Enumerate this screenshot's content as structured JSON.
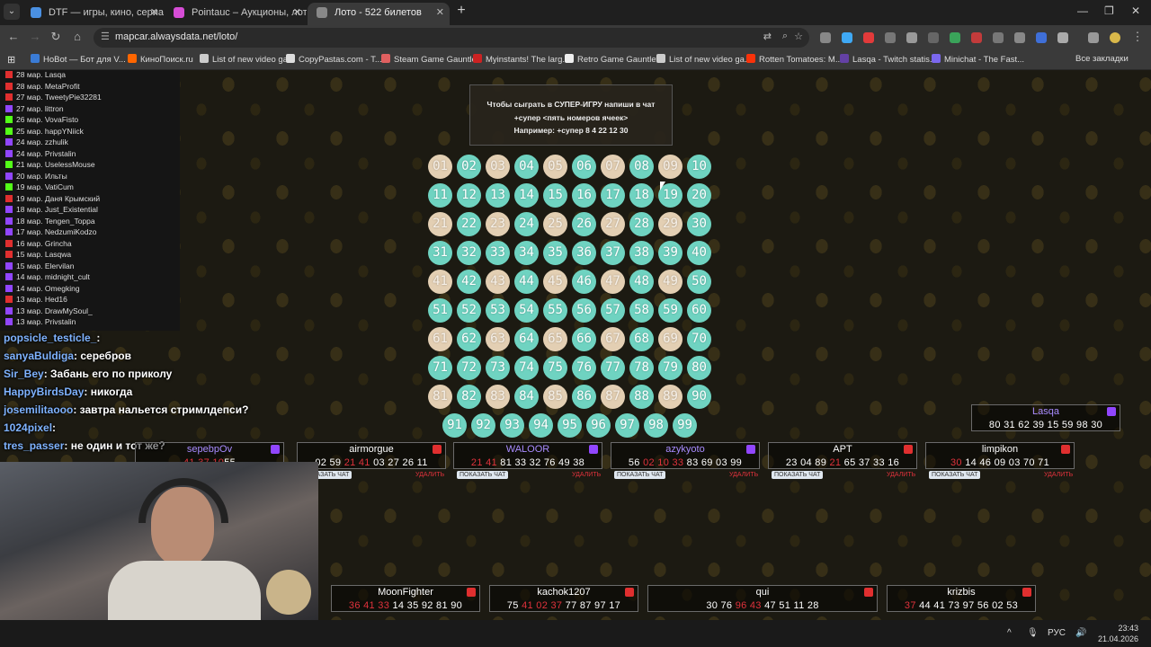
{
  "browser": {
    "tabs": [
      {
        "title": "DTF — игры, кино, сериалы, р",
        "active": false,
        "color": "#4a90e2"
      },
      {
        "title": "Pointauc – Аукционы, лотере",
        "active": false,
        "color": "#d64dd6"
      },
      {
        "title": "Лото - 522 билетов",
        "active": true,
        "color": "#888888"
      }
    ],
    "url": "mapcar.alwaysdata.net/loto/",
    "bookmarks": [
      {
        "label": "HoBot — Бот для V...",
        "color": "#3a7bd5"
      },
      {
        "label": "КиноПоиск.ru",
        "color": "#ff6600"
      },
      {
        "label": "List of new video ga...",
        "color": "#cccccc"
      },
      {
        "label": "CopyPastas.com - T...",
        "color": "#dddddd"
      },
      {
        "label": "Steam Game Gauntlet",
        "color": "#e06060"
      },
      {
        "label": "Myinstants! The larg...",
        "color": "#cc2222"
      },
      {
        "label": "Retro Game Gauntlet",
        "color": "#eeeeee"
      },
      {
        "label": "List of new video ga...",
        "color": "#cccccc"
      },
      {
        "label": "Rotten Tomatoes: M...",
        "color": "#fa320a"
      },
      {
        "label": "Lasqa - Twitch statis...",
        "color": "#6441a5"
      },
      {
        "label": "Minichat - The Fast...",
        "color": "#7b68ee"
      }
    ],
    "all_bookmarks": "Все закладки"
  },
  "chat_history": [
    {
      "text": "28 мар. Lasqa",
      "platform": "youtube"
    },
    {
      "text": "28 мар. MetaProfit",
      "platform": "youtube"
    },
    {
      "text": "27 мар. TweetyPie32281",
      "platform": "youtube"
    },
    {
      "text": "27 мар. littron",
      "platform": "twitch"
    },
    {
      "text": "26 мар. VovaFisto",
      "platform": "kick"
    },
    {
      "text": "25 мар. happYNiick",
      "platform": "kick"
    },
    {
      "text": "24 мар. zzhulik",
      "platform": "twitch"
    },
    {
      "text": "24 мар. Privstalin",
      "platform": "twitch"
    },
    {
      "text": "21 мар. UselessMouse",
      "platform": "kick"
    },
    {
      "text": "20 мар. Ильты",
      "platform": "twitch"
    },
    {
      "text": "19 мар. VatiCum",
      "platform": "kick"
    },
    {
      "text": "19 мар. Даня Крымский",
      "platform": "youtube"
    },
    {
      "text": "18 мар. Just_Existential",
      "platform": "twitch"
    },
    {
      "text": "18 мар. Tengen_Toppa",
      "platform": "twitch"
    },
    {
      "text": "17 мар. NedzumiKodzo",
      "platform": "twitch"
    },
    {
      "text": "16 мар. Grincha",
      "platform": "youtube"
    },
    {
      "text": "15 мар. Lasqwa",
      "platform": "youtube"
    },
    {
      "text": "15 мар. Elervilan",
      "platform": "twitch"
    },
    {
      "text": "14 мар. midnight_cult",
      "platform": "twitch"
    },
    {
      "text": "14 мар. Omegking",
      "platform": "twitch"
    },
    {
      "text": "13 мар. Hed16",
      "platform": "youtube"
    },
    {
      "text": "13 мар. DrawMySoul_",
      "platform": "twitch"
    },
    {
      "text": "13 мар. Privstalin",
      "platform": "twitch"
    }
  ],
  "overlay_chat": [
    {
      "name": "popsicle_testicle_",
      "text": ":"
    },
    {
      "name": "sanyaBuldiga",
      "text": ": серебров"
    },
    {
      "name": "Sir_Bey",
      "text": ": Забань его по приколу"
    },
    {
      "name": "HappyBirdsDay",
      "text": ": никогда"
    },
    {
      "name": "josemilitaooo",
      "text": ": завтра нальется стримлдепси?"
    },
    {
      "name": "1024pixel",
      "text": ":"
    },
    {
      "name": "tres_passer",
      "text": ": не один и тот же?"
    }
  ],
  "info_box": {
    "line1": "Чтобы сыграть в СУПЕР-ИГРУ напиши в чат",
    "line2": "+супер <пять номеров ячеек>",
    "line3": "Например: +супер 8 4 22 12 30"
  },
  "balls": [
    {
      "n": "01",
      "c": "b"
    },
    {
      "n": "02",
      "c": "t"
    },
    {
      "n": "03",
      "c": "b"
    },
    {
      "n": "04",
      "c": "t"
    },
    {
      "n": "05",
      "c": "b"
    },
    {
      "n": "06",
      "c": "t"
    },
    {
      "n": "07",
      "c": "b"
    },
    {
      "n": "08",
      "c": "t"
    },
    {
      "n": "09",
      "c": "b"
    },
    {
      "n": "10",
      "c": "t"
    },
    {
      "n": "11",
      "c": "t"
    },
    {
      "n": "12",
      "c": "t"
    },
    {
      "n": "13",
      "c": "t"
    },
    {
      "n": "14",
      "c": "t"
    },
    {
      "n": "15",
      "c": "t"
    },
    {
      "n": "16",
      "c": "t"
    },
    {
      "n": "17",
      "c": "t"
    },
    {
      "n": "18",
      "c": "t"
    },
    {
      "n": "19",
      "c": "t"
    },
    {
      "n": "20",
      "c": "t"
    },
    {
      "n": "21",
      "c": "b"
    },
    {
      "n": "22",
      "c": "t"
    },
    {
      "n": "23",
      "c": "b"
    },
    {
      "n": "24",
      "c": "t"
    },
    {
      "n": "25",
      "c": "b"
    },
    {
      "n": "26",
      "c": "t"
    },
    {
      "n": "27",
      "c": "b"
    },
    {
      "n": "28",
      "c": "t"
    },
    {
      "n": "29",
      "c": "b"
    },
    {
      "n": "30",
      "c": "t"
    },
    {
      "n": "31",
      "c": "t"
    },
    {
      "n": "32",
      "c": "t"
    },
    {
      "n": "33",
      "c": "t"
    },
    {
      "n": "34",
      "c": "t"
    },
    {
      "n": "35",
      "c": "t"
    },
    {
      "n": "36",
      "c": "t"
    },
    {
      "n": "37",
      "c": "t"
    },
    {
      "n": "38",
      "c": "t"
    },
    {
      "n": "39",
      "c": "t"
    },
    {
      "n": "40",
      "c": "t"
    },
    {
      "n": "41",
      "c": "b"
    },
    {
      "n": "42",
      "c": "t"
    },
    {
      "n": "43",
      "c": "b"
    },
    {
      "n": "44",
      "c": "t"
    },
    {
      "n": "45",
      "c": "b"
    },
    {
      "n": "46",
      "c": "t"
    },
    {
      "n": "47",
      "c": "b"
    },
    {
      "n": "48",
      "c": "t"
    },
    {
      "n": "49",
      "c": "b"
    },
    {
      "n": "50",
      "c": "t"
    },
    {
      "n": "51",
      "c": "t"
    },
    {
      "n": "52",
      "c": "t"
    },
    {
      "n": "53",
      "c": "t"
    },
    {
      "n": "54",
      "c": "t"
    },
    {
      "n": "55",
      "c": "t"
    },
    {
      "n": "56",
      "c": "t"
    },
    {
      "n": "57",
      "c": "t"
    },
    {
      "n": "58",
      "c": "t"
    },
    {
      "n": "59",
      "c": "t"
    },
    {
      "n": "60",
      "c": "t"
    },
    {
      "n": "61",
      "c": "b"
    },
    {
      "n": "62",
      "c": "t"
    },
    {
      "n": "63",
      "c": "b"
    },
    {
      "n": "64",
      "c": "t"
    },
    {
      "n": "65",
      "c": "b"
    },
    {
      "n": "66",
      "c": "t"
    },
    {
      "n": "67",
      "c": "b"
    },
    {
      "n": "68",
      "c": "t"
    },
    {
      "n": "69",
      "c": "b"
    },
    {
      "n": "70",
      "c": "t"
    },
    {
      "n": "71",
      "c": "t"
    },
    {
      "n": "72",
      "c": "t"
    },
    {
      "n": "73",
      "c": "t"
    },
    {
      "n": "74",
      "c": "t"
    },
    {
      "n": "75",
      "c": "t"
    },
    {
      "n": "76",
      "c": "t"
    },
    {
      "n": "77",
      "c": "t"
    },
    {
      "n": "78",
      "c": "t"
    },
    {
      "n": "79",
      "c": "t"
    },
    {
      "n": "80",
      "c": "t"
    },
    {
      "n": "81",
      "c": "b"
    },
    {
      "n": "82",
      "c": "t"
    },
    {
      "n": "83",
      "c": "b"
    },
    {
      "n": "84",
      "c": "t"
    },
    {
      "n": "85",
      "c": "b"
    },
    {
      "n": "86",
      "c": "t"
    },
    {
      "n": "87",
      "c": "b"
    },
    {
      "n": "88",
      "c": "t"
    },
    {
      "n": "89",
      "c": "b"
    },
    {
      "n": "90",
      "c": "t"
    },
    {
      "n": "91",
      "c": "t"
    },
    {
      "n": "92",
      "c": "t"
    },
    {
      "n": "93",
      "c": "t"
    },
    {
      "n": "94",
      "c": "t"
    },
    {
      "n": "95",
      "c": "t"
    },
    {
      "n": "96",
      "c": "t"
    },
    {
      "n": "97",
      "c": "t"
    },
    {
      "n": "98",
      "c": "t"
    },
    {
      "n": "99",
      "c": "t"
    }
  ],
  "tickets_row1": [
    {
      "name": "sepebpOv",
      "tw": true,
      "nums": [
        [
          "",
          ""
        ],
        [
          "41 37 10",
          ""
        ],
        [
          "55",
          ""
        ]
      ],
      "hits": "41 37 10",
      "tail": "55",
      "pre": ""
    },
    {
      "name": "airmorgue",
      "tw": false,
      "pre": "02 59 ",
      "hits": "21 41",
      "tail": " 03 27 26 11"
    },
    {
      "name": "WALOOR",
      "tw": true,
      "pre": "",
      "hits": "21 41",
      "tail": " 81 33 32 76 49 38"
    },
    {
      "name": "azykyoto",
      "tw": true,
      "pre": "56 ",
      "hits": "02 10 33",
      "tail": " 83 69 03 99"
    },
    {
      "name": "APT",
      "tw": false,
      "pre": "23 04 89 ",
      "hits": "21",
      "tail": " 65 37 33 16"
    },
    {
      "name": "limpikon",
      "tw": false,
      "pre": "",
      "hits": "30",
      "tail": " 14 46 09 03 70 71"
    }
  ],
  "ticket_lasqa": {
    "name": "Lasqa",
    "nums": "80 31 62 39 15 59 98 30"
  },
  "tickets_row2": [
    {
      "name": "MoonFighter",
      "pre": "",
      "hits": "36 41 33",
      "tail": " 14 35 92 81 90"
    },
    {
      "name": "kachok1207",
      "pre": "75 ",
      "hits": "41 02 37",
      "tail": " 77 87 97 17"
    },
    {
      "name": "qui",
      "pre": "30 76 ",
      "hits": "96 43",
      "tail": " 47 51 11 28"
    },
    {
      "name": "krizbis",
      "pre": "",
      "hits": "37",
      "tail": " 44 41 73 97 56 02 53"
    }
  ],
  "labels": {
    "show_chat": "ПОКАЗАТЬ ЧАТ",
    "delete": "УДАЛИТЬ"
  },
  "taskbar": {
    "lang": "РУС",
    "time": "23:43",
    "date": "21.04.2026"
  }
}
